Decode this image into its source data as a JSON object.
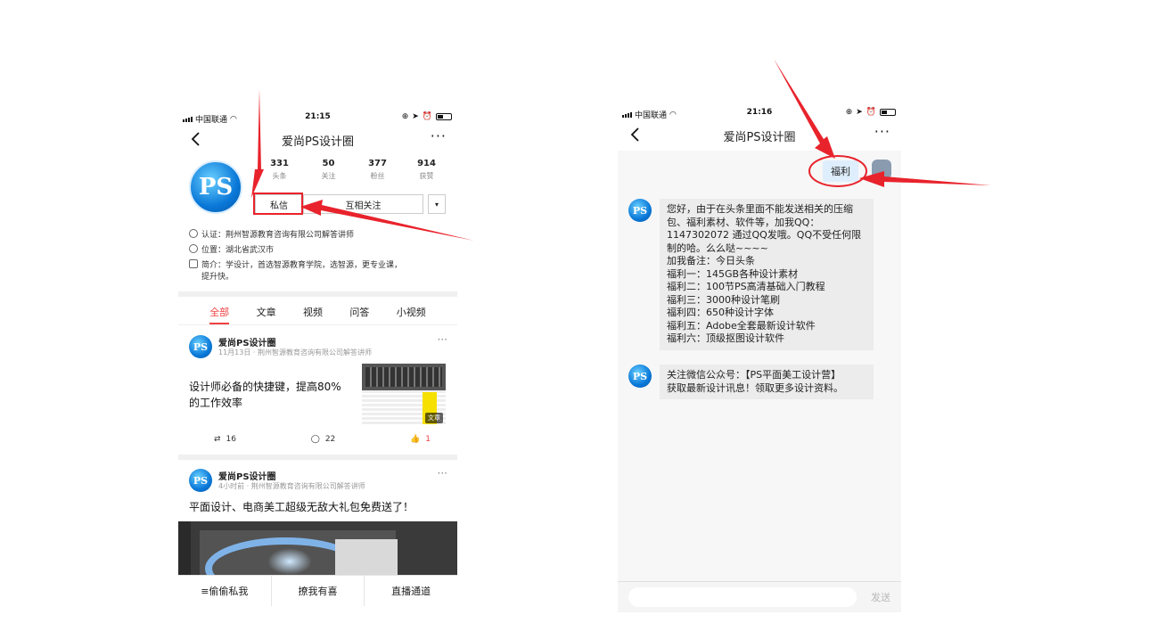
{
  "left": {
    "status": {
      "carrier": "中国联通",
      "time": "21:15"
    },
    "title": "爱尚PS设计圈",
    "avatar_text": "PS",
    "stats": [
      {
        "num": "331",
        "label": "头条"
      },
      {
        "num": "50",
        "label": "关注"
      },
      {
        "num": "377",
        "label": "粉丝"
      },
      {
        "num": "914",
        "label": "获赞"
      }
    ],
    "buttons": {
      "message": "私信",
      "follow": "互相关注",
      "dropdown": "▾"
    },
    "info": {
      "cert": "认证：荆州智源教育咨询有限公司解答讲师",
      "location": "位置：湖北省武汉市",
      "intro_1": "简介：学设计，首选智源教育学院，选智源，更专业课，",
      "intro_2": "提升快。"
    },
    "tabs": [
      "全部",
      "文章",
      "视频",
      "问答",
      "小视频"
    ],
    "posts": [
      {
        "name": "爱尚PS设计圈",
        "meta": "11月13日 · 荆州智源教育咨询有限公司解答讲师",
        "title_1": "设计师必备的快捷键，提高80%",
        "title_2": "的工作效率",
        "thumb_tag": "文章",
        "shares": "16",
        "comments": "22",
        "likes": "1"
      },
      {
        "name": "爱尚PS设计圈",
        "meta": "4小时前 · 荆州智源教育咨询有限公司解答讲师",
        "title_1": "平面设计、电商美工超级无敌大礼包免费送了！"
      }
    ],
    "bottom_menu": [
      "≡偷偷私我",
      "撩我有喜",
      "直播通道"
    ]
  },
  "right": {
    "status": {
      "carrier": "中国联通",
      "time": "21:16"
    },
    "title": "爱尚PS设计圈",
    "my_message": "福利",
    "avatar_text": "PS",
    "reply_lines": [
      "您好，由于在头条里面不能发送相关的压缩",
      "包、福利素材、软件等，加我QQ：",
      "1147302072 通过QQ发哦。QQ不受任何限",
      "制的哈。么么哒~~~~",
      "加我备注：今日头条",
      "福利一：145GB各种设计素材",
      "福利二：100节PS高清基础入门教程",
      "福利三：3000种设计笔刷",
      "福利四：650种设计字体",
      "福利五：Adobe全套最新设计软件",
      "福利六：顶级抠图设计软件"
    ],
    "notice_lines": [
      "关注微信公众号：【PS平面美工设计营】",
      "获取最新设计讯息！领取更多设计资料。"
    ],
    "send": "发送"
  },
  "colors": {
    "accent_red": "#f04142",
    "annotation_red": "#e8232c"
  }
}
